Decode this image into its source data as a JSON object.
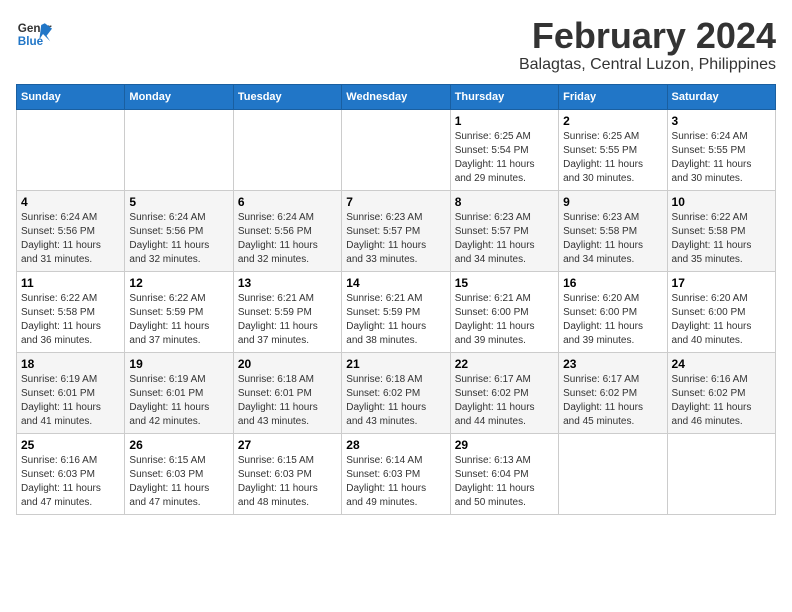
{
  "app": {
    "name": "GeneralBlue",
    "title": "February 2024",
    "subtitle": "Balagtas, Central Luzon, Philippines"
  },
  "calendar": {
    "headers": [
      "Sunday",
      "Monday",
      "Tuesday",
      "Wednesday",
      "Thursday",
      "Friday",
      "Saturday"
    ],
    "weeks": [
      [
        {
          "day": "",
          "info": ""
        },
        {
          "day": "",
          "info": ""
        },
        {
          "day": "",
          "info": ""
        },
        {
          "day": "",
          "info": ""
        },
        {
          "day": "1",
          "info": "Sunrise: 6:25 AM\nSunset: 5:54 PM\nDaylight: 11 hours\nand 29 minutes."
        },
        {
          "day": "2",
          "info": "Sunrise: 6:25 AM\nSunset: 5:55 PM\nDaylight: 11 hours\nand 30 minutes."
        },
        {
          "day": "3",
          "info": "Sunrise: 6:24 AM\nSunset: 5:55 PM\nDaylight: 11 hours\nand 30 minutes."
        }
      ],
      [
        {
          "day": "4",
          "info": "Sunrise: 6:24 AM\nSunset: 5:56 PM\nDaylight: 11 hours\nand 31 minutes."
        },
        {
          "day": "5",
          "info": "Sunrise: 6:24 AM\nSunset: 5:56 PM\nDaylight: 11 hours\nand 32 minutes."
        },
        {
          "day": "6",
          "info": "Sunrise: 6:24 AM\nSunset: 5:56 PM\nDaylight: 11 hours\nand 32 minutes."
        },
        {
          "day": "7",
          "info": "Sunrise: 6:23 AM\nSunset: 5:57 PM\nDaylight: 11 hours\nand 33 minutes."
        },
        {
          "day": "8",
          "info": "Sunrise: 6:23 AM\nSunset: 5:57 PM\nDaylight: 11 hours\nand 34 minutes."
        },
        {
          "day": "9",
          "info": "Sunrise: 6:23 AM\nSunset: 5:58 PM\nDaylight: 11 hours\nand 34 minutes."
        },
        {
          "day": "10",
          "info": "Sunrise: 6:22 AM\nSunset: 5:58 PM\nDaylight: 11 hours\nand 35 minutes."
        }
      ],
      [
        {
          "day": "11",
          "info": "Sunrise: 6:22 AM\nSunset: 5:58 PM\nDaylight: 11 hours\nand 36 minutes."
        },
        {
          "day": "12",
          "info": "Sunrise: 6:22 AM\nSunset: 5:59 PM\nDaylight: 11 hours\nand 37 minutes."
        },
        {
          "day": "13",
          "info": "Sunrise: 6:21 AM\nSunset: 5:59 PM\nDaylight: 11 hours\nand 37 minutes."
        },
        {
          "day": "14",
          "info": "Sunrise: 6:21 AM\nSunset: 5:59 PM\nDaylight: 11 hours\nand 38 minutes."
        },
        {
          "day": "15",
          "info": "Sunrise: 6:21 AM\nSunset: 6:00 PM\nDaylight: 11 hours\nand 39 minutes."
        },
        {
          "day": "16",
          "info": "Sunrise: 6:20 AM\nSunset: 6:00 PM\nDaylight: 11 hours\nand 39 minutes."
        },
        {
          "day": "17",
          "info": "Sunrise: 6:20 AM\nSunset: 6:00 PM\nDaylight: 11 hours\nand 40 minutes."
        }
      ],
      [
        {
          "day": "18",
          "info": "Sunrise: 6:19 AM\nSunset: 6:01 PM\nDaylight: 11 hours\nand 41 minutes."
        },
        {
          "day": "19",
          "info": "Sunrise: 6:19 AM\nSunset: 6:01 PM\nDaylight: 11 hours\nand 42 minutes."
        },
        {
          "day": "20",
          "info": "Sunrise: 6:18 AM\nSunset: 6:01 PM\nDaylight: 11 hours\nand 43 minutes."
        },
        {
          "day": "21",
          "info": "Sunrise: 6:18 AM\nSunset: 6:02 PM\nDaylight: 11 hours\nand 43 minutes."
        },
        {
          "day": "22",
          "info": "Sunrise: 6:17 AM\nSunset: 6:02 PM\nDaylight: 11 hours\nand 44 minutes."
        },
        {
          "day": "23",
          "info": "Sunrise: 6:17 AM\nSunset: 6:02 PM\nDaylight: 11 hours\nand 45 minutes."
        },
        {
          "day": "24",
          "info": "Sunrise: 6:16 AM\nSunset: 6:02 PM\nDaylight: 11 hours\nand 46 minutes."
        }
      ],
      [
        {
          "day": "25",
          "info": "Sunrise: 6:16 AM\nSunset: 6:03 PM\nDaylight: 11 hours\nand 47 minutes."
        },
        {
          "day": "26",
          "info": "Sunrise: 6:15 AM\nSunset: 6:03 PM\nDaylight: 11 hours\nand 47 minutes."
        },
        {
          "day": "27",
          "info": "Sunrise: 6:15 AM\nSunset: 6:03 PM\nDaylight: 11 hours\nand 48 minutes."
        },
        {
          "day": "28",
          "info": "Sunrise: 6:14 AM\nSunset: 6:03 PM\nDaylight: 11 hours\nand 49 minutes."
        },
        {
          "day": "29",
          "info": "Sunrise: 6:13 AM\nSunset: 6:04 PM\nDaylight: 11 hours\nand 50 minutes."
        },
        {
          "day": "",
          "info": ""
        },
        {
          "day": "",
          "info": ""
        }
      ]
    ]
  }
}
